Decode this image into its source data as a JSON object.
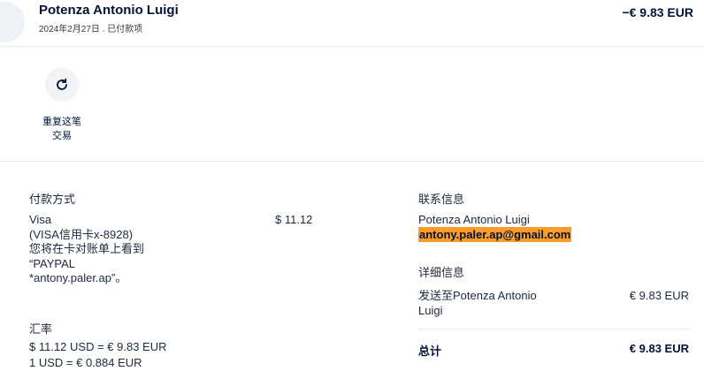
{
  "header": {
    "merchant_name": "Potenza Antonio Luigi",
    "date_status": "2024年2月27日 . 已付款项",
    "amount": "−€ 9.83 EUR"
  },
  "actions": {
    "repeat_label_line1": "重复这笔",
    "repeat_label_line2": "交易"
  },
  "payment": {
    "heading": "付款方式",
    "method_lines": [
      "Visa",
      "(VISA信用卡x-8928)",
      "您将在卡对账单上看到",
      "“PAYPAL",
      "*antony.paler.ap”。"
    ],
    "amount": "$ 11.12"
  },
  "exchange": {
    "heading": "汇率",
    "conversion": "$ 11.12 USD = € 9.83 EUR",
    "rate_partial": "1 USD = € 0.884 EUR"
  },
  "contact": {
    "heading": "联系信息",
    "name": "Potenza Antonio Luigi",
    "email": "antony.paler.ap@gmail.com"
  },
  "details": {
    "heading": "详细信息",
    "sent_to_line1": "发送至Potenza Antonio",
    "sent_to_line2": "Luigi",
    "sent_amount": "€ 9.83 EUR",
    "total_label": "总计",
    "total_amount": "€ 9.83 EUR"
  },
  "colors": {
    "text": "#001435",
    "divider": "#e3e6ea",
    "highlight": "#ff9b28"
  },
  "icons": {
    "repeat": "refresh-icon"
  }
}
